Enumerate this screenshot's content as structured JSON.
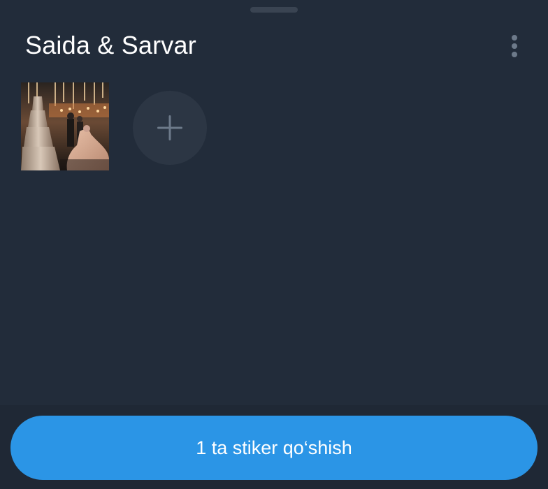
{
  "sheet": {
    "title": "Saida & Sarvar",
    "menu_icon": "more-vertical-icon"
  },
  "stickers": {
    "items": [
      {
        "name": "sticker-thumbnail-wedding-photo"
      }
    ],
    "add_icon": "plus-icon"
  },
  "footer": {
    "add_button_label": "1 ta stiker qo‘shish"
  },
  "colors": {
    "background": "#222c3a",
    "add_circle": "#2c3644",
    "accent": "#2b95e6",
    "text_primary": "#ffffff",
    "icon_muted": "#6d7a8a"
  }
}
